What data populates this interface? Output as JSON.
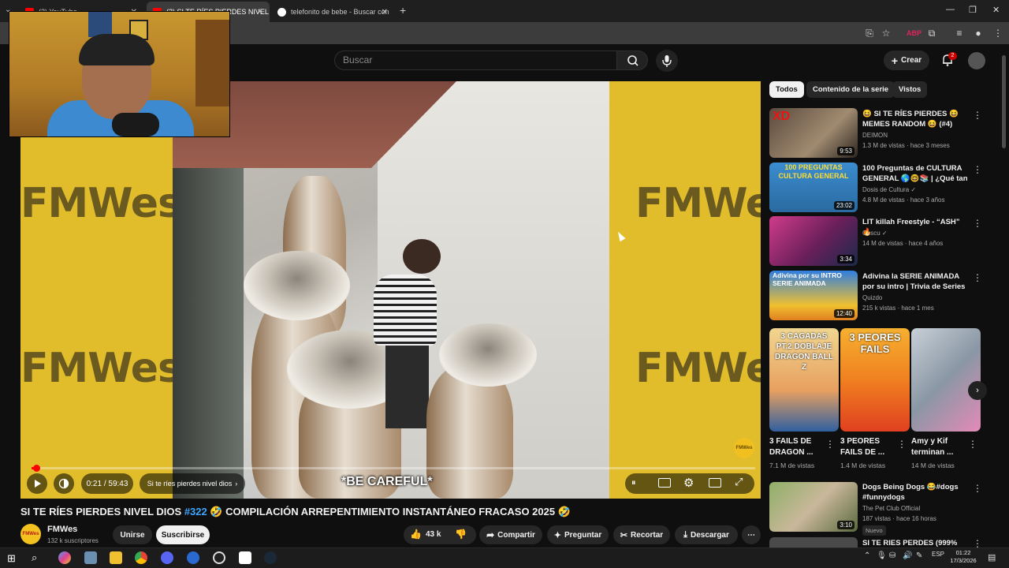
{
  "browser": {
    "tabs": [
      {
        "label": "(2) YouTube",
        "active": false
      },
      {
        "label": "(2) SI TE RÍES PIERDES NIVEL DI",
        "active": true
      },
      {
        "label": "telefonito de bebe - Buscar con",
        "active": false
      }
    ],
    "new_tab_icon": "plus-icon",
    "window_controls": [
      "minimize-icon",
      "restore-icon",
      "close-icon"
    ]
  },
  "header": {
    "search_placeholder": "Buscar",
    "create_label": "Crear",
    "notifications_count": "2"
  },
  "player": {
    "watermark_text": "FMWes",
    "caption": "*BE CAREFUL*",
    "time_current": "0:21",
    "time_total": "59:43",
    "time_display": "0:21 / 59:43",
    "chapter_label": "Si te ríes pierdes nivel dios",
    "progress_fraction": 0.006,
    "logo_text": "FMWes"
  },
  "video": {
    "title_part1": "SI TE RÍES PIERDES NIVEL DIOS ",
    "title_tag": "#322",
    "title_part2": " 🤣 COMPILACIÓN ARREPENTIMIENTO INSTANTÁNEO FRACASO 2025 🤣",
    "channel_name": "FMWes",
    "channel_subs": "132 k suscriptores",
    "join_label": "Unirse",
    "subscribe_label": "Suscribirse",
    "likes": "43 k",
    "share_label": "Compartir",
    "ask_label": "Preguntar",
    "clip_label": "Recortar",
    "download_label": "Descargar"
  },
  "chips": [
    "Todos",
    "Contenido de la serie",
    "Vistos"
  ],
  "recommendations": [
    {
      "title": "😆 SI TE RÍES PIERDES 😆 MEMES RANDOM 😆 (#4)",
      "channel": "DEIMON",
      "meta": "1.3 M de vistas · hace 3 meses",
      "duration": "9:53",
      "thumb_text": "XD",
      "thumb_color": "#6b5a4a"
    },
    {
      "title": "100 Preguntas de CULTURA GENERAL 🌎🤓📚 | ¿Qué tan ...",
      "channel": "Dosis de Cultura ✓",
      "meta": "4.8 M de vistas · hace 3 años",
      "duration": "23:02",
      "thumb_text": "100 PREGUNTAS CULTURA GENERAL",
      "thumb_color": "#2d7fb8"
    },
    {
      "title": "LIT killah Freestyle - “ASH” 🔥",
      "channel": "Coscu ✓",
      "meta": "14 M de vistas · hace 4 años",
      "duration": "3:34",
      "thumb_text": "",
      "thumb_color": "#b0306a"
    },
    {
      "title": "Adivina la SERIE ANIMADA por su intro | Trivia de Series",
      "channel": "Quizdo",
      "meta": "215 k vistas · hace 1 mes",
      "duration": "12:40",
      "thumb_text": "Adivina por su INTRO SERIE ANIMADA",
      "thumb_color": "#2a6fd6"
    },
    {
      "title": "Dogs Being Dogs 😂#dogs #funnydogs",
      "channel": "The Pet Club Official",
      "meta": "187 vistas · hace 16 horas",
      "duration": "3:10",
      "thumb_text": "",
      "thumb_color": "#7a9a5a",
      "badge": "Nuevo"
    },
    {
      "title": "SI TE RIES PERDES (999%",
      "channel": "",
      "meta": "",
      "duration": "",
      "thumb_text": "",
      "thumb_color": "#444"
    }
  ],
  "shorts": [
    {
      "title": "3 FAILS DE DRAGON ...",
      "views": "7.1 M de vistas",
      "thumb_text": "3 CAGADAS PT.2 DOBLAJE DRAGON BALL Z",
      "thumb_color": "#e8c46a"
    },
    {
      "title": "3 PEORES FAILS DE ...",
      "views": "1.4 M de vistas",
      "thumb_text": "3 PEORES FAILS",
      "thumb_color": "#f0a030"
    },
    {
      "title": "Amy y Kif terminan ...",
      "views": "14 M de vistas",
      "thumb_text": "",
      "thumb_color": "#9aa8b5"
    }
  ],
  "taskbar": {
    "tray_lang": "ESP",
    "time": "01:22",
    "date": "17/3/2026"
  },
  "colors": {
    "yt_red": "#ff0000",
    "link_blue": "#3ea6ff",
    "player_bg": "#e1bd2c",
    "page_bg": "#0f0f0f"
  }
}
